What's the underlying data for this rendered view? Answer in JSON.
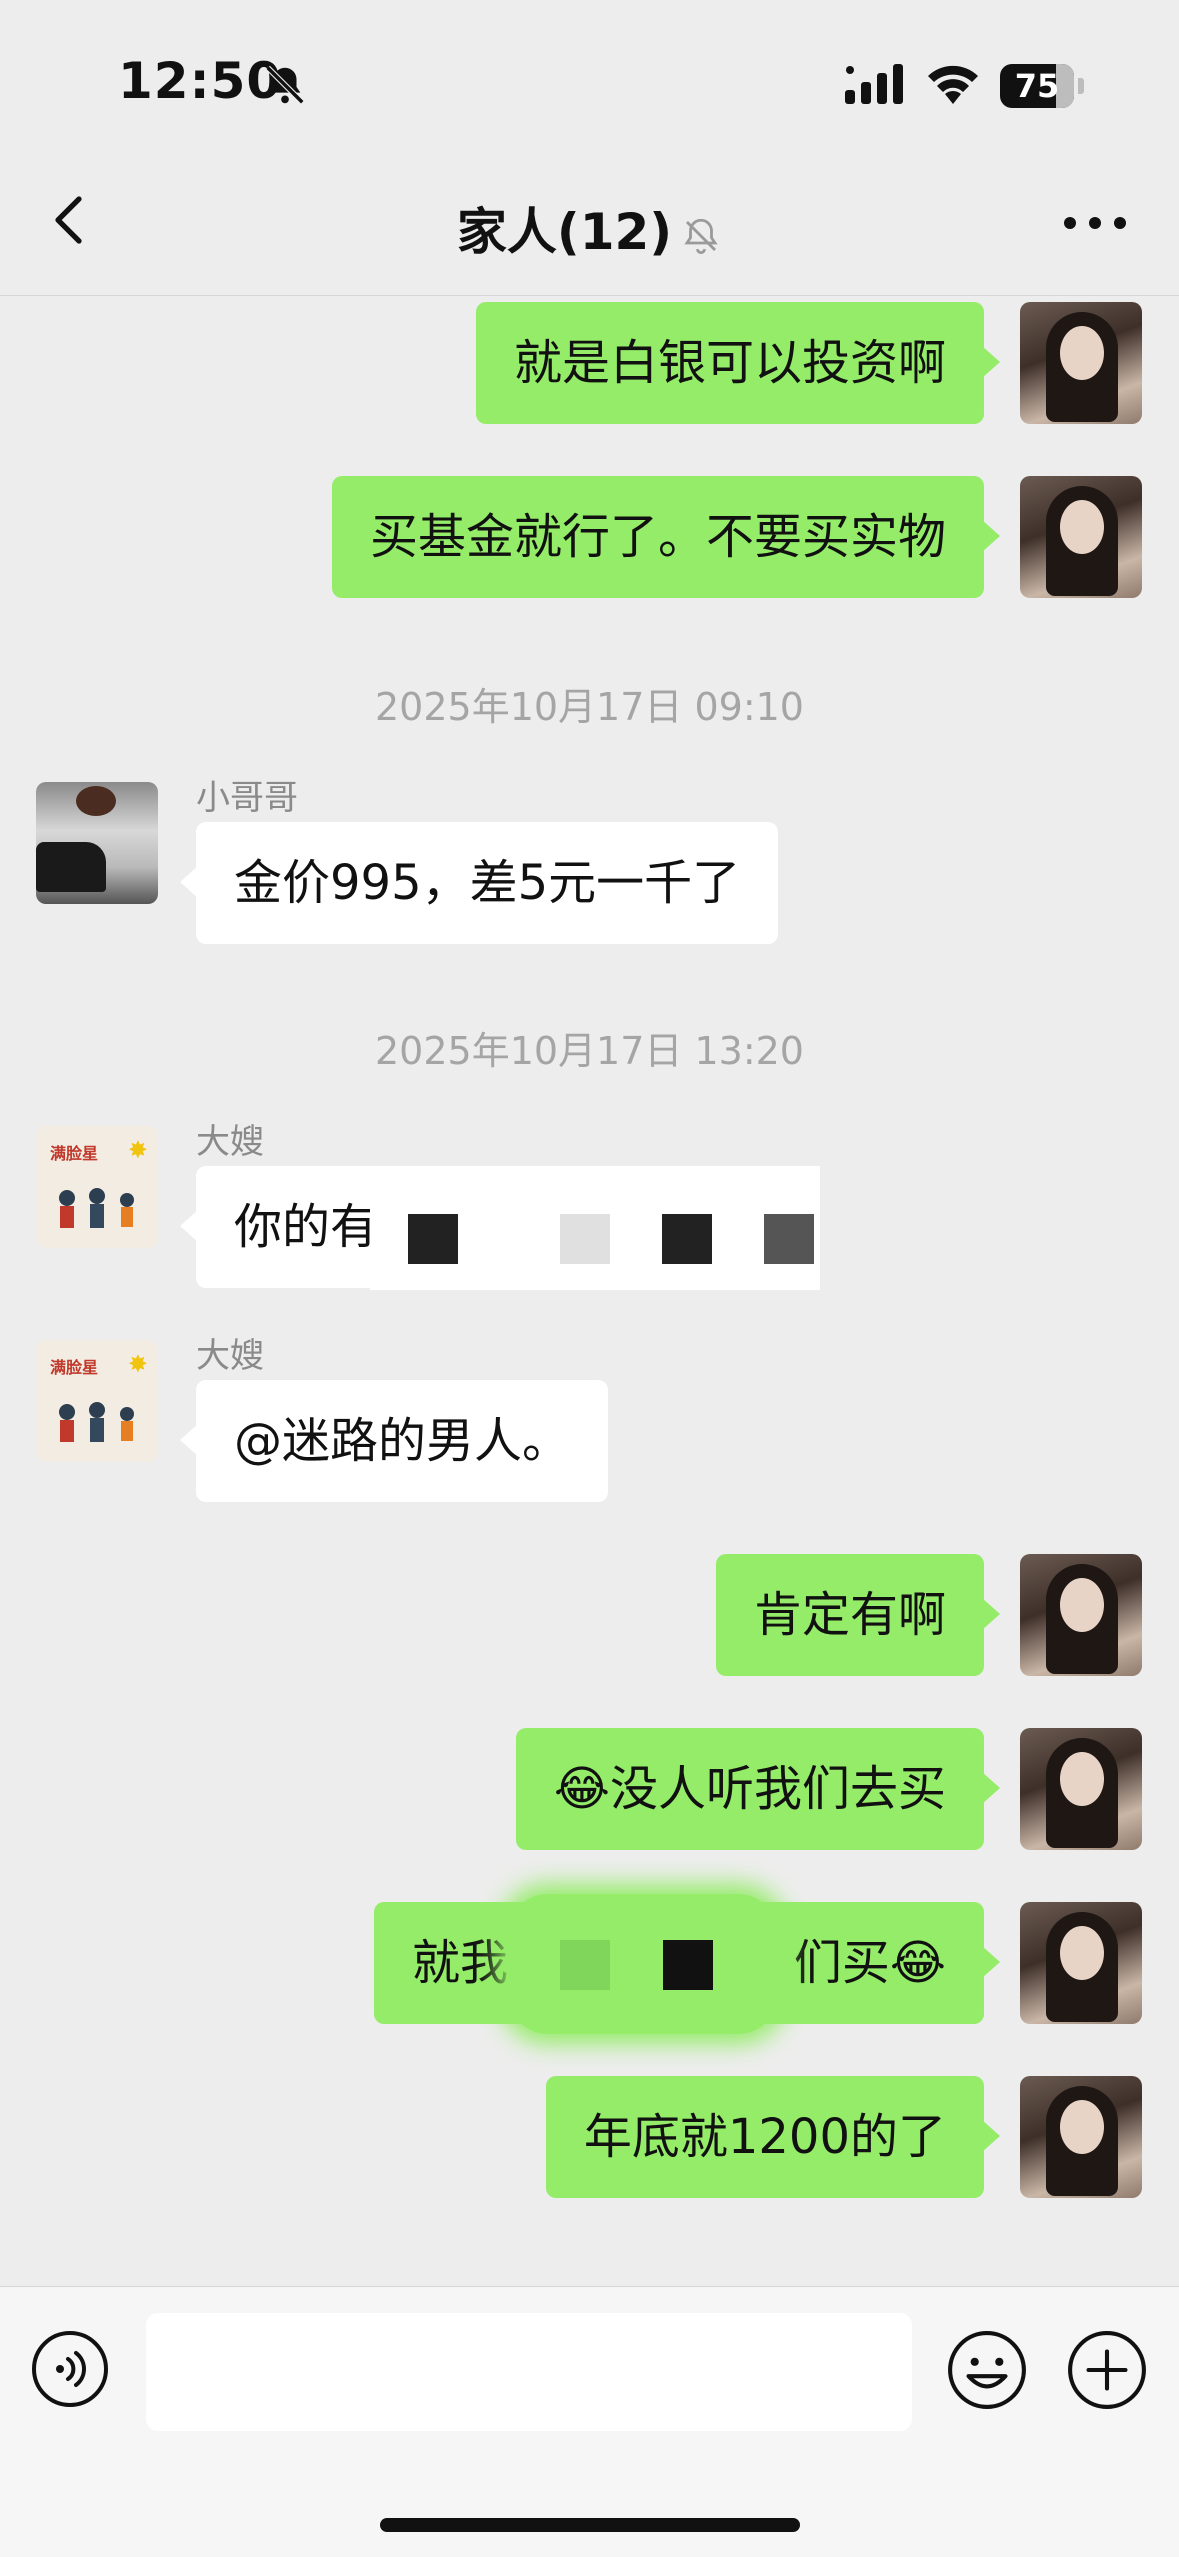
{
  "status_bar": {
    "time": "12:50",
    "battery": "75"
  },
  "nav": {
    "title": "家人(12)"
  },
  "messages": [
    {
      "text": "就是白银可以投资啊"
    },
    {
      "text": "买基金就行了。不要买实物"
    },
    {
      "stamp": "2025年10月17日 09:10"
    },
    {
      "sender": "小哥哥",
      "text": "金价995，差5元一千了"
    },
    {
      "stamp": "2025年10月17日 13:20"
    },
    {
      "sender": "大嫂",
      "text": "你的有"
    },
    {
      "sender": "大嫂",
      "text": "@迷路的男人。"
    },
    {
      "text": "肯定有啊"
    },
    {
      "text": "😂没人听我们去买"
    },
    {
      "text_start": "就我",
      "text_end": "们买😂"
    },
    {
      "text": "年底就1200的了"
    }
  ],
  "input_bar": {
    "placeholder": ""
  }
}
